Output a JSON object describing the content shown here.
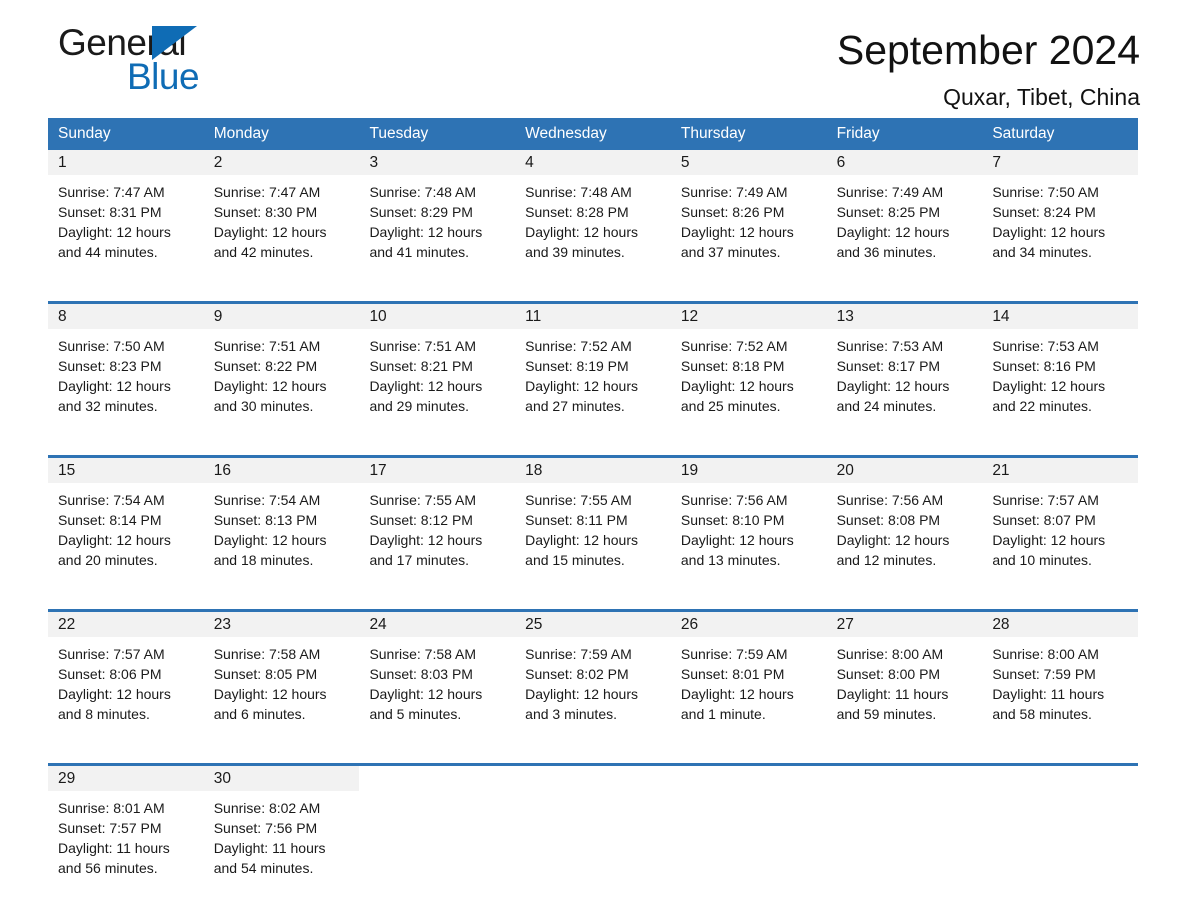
{
  "brand": {
    "name_part1": "General",
    "name_part2": "Blue",
    "logo_icon": "triangle-logo-icon",
    "accent_color": "#0f6cb5"
  },
  "header": {
    "month_title": "September 2024",
    "location": "Quxar, Tibet, China"
  },
  "calendar": {
    "header_bg": "#2e73b4",
    "day_band_bg": "#f2f2f2",
    "weekdays": [
      "Sunday",
      "Monday",
      "Tuesday",
      "Wednesday",
      "Thursday",
      "Friday",
      "Saturday"
    ],
    "weeks": [
      [
        {
          "date": "1",
          "sunrise": "Sunrise: 7:47 AM",
          "sunset": "Sunset: 8:31 PM",
          "daylight": "Daylight: 12 hours and 44 minutes."
        },
        {
          "date": "2",
          "sunrise": "Sunrise: 7:47 AM",
          "sunset": "Sunset: 8:30 PM",
          "daylight": "Daylight: 12 hours and 42 minutes."
        },
        {
          "date": "3",
          "sunrise": "Sunrise: 7:48 AM",
          "sunset": "Sunset: 8:29 PM",
          "daylight": "Daylight: 12 hours and 41 minutes."
        },
        {
          "date": "4",
          "sunrise": "Sunrise: 7:48 AM",
          "sunset": "Sunset: 8:28 PM",
          "daylight": "Daylight: 12 hours and 39 minutes."
        },
        {
          "date": "5",
          "sunrise": "Sunrise: 7:49 AM",
          "sunset": "Sunset: 8:26 PM",
          "daylight": "Daylight: 12 hours and 37 minutes."
        },
        {
          "date": "6",
          "sunrise": "Sunrise: 7:49 AM",
          "sunset": "Sunset: 8:25 PM",
          "daylight": "Daylight: 12 hours and 36 minutes."
        },
        {
          "date": "7",
          "sunrise": "Sunrise: 7:50 AM",
          "sunset": "Sunset: 8:24 PM",
          "daylight": "Daylight: 12 hours and 34 minutes."
        }
      ],
      [
        {
          "date": "8",
          "sunrise": "Sunrise: 7:50 AM",
          "sunset": "Sunset: 8:23 PM",
          "daylight": "Daylight: 12 hours and 32 minutes."
        },
        {
          "date": "9",
          "sunrise": "Sunrise: 7:51 AM",
          "sunset": "Sunset: 8:22 PM",
          "daylight": "Daylight: 12 hours and 30 minutes."
        },
        {
          "date": "10",
          "sunrise": "Sunrise: 7:51 AM",
          "sunset": "Sunset: 8:21 PM",
          "daylight": "Daylight: 12 hours and 29 minutes."
        },
        {
          "date": "11",
          "sunrise": "Sunrise: 7:52 AM",
          "sunset": "Sunset: 8:19 PM",
          "daylight": "Daylight: 12 hours and 27 minutes."
        },
        {
          "date": "12",
          "sunrise": "Sunrise: 7:52 AM",
          "sunset": "Sunset: 8:18 PM",
          "daylight": "Daylight: 12 hours and 25 minutes."
        },
        {
          "date": "13",
          "sunrise": "Sunrise: 7:53 AM",
          "sunset": "Sunset: 8:17 PM",
          "daylight": "Daylight: 12 hours and 24 minutes."
        },
        {
          "date": "14",
          "sunrise": "Sunrise: 7:53 AM",
          "sunset": "Sunset: 8:16 PM",
          "daylight": "Daylight: 12 hours and 22 minutes."
        }
      ],
      [
        {
          "date": "15",
          "sunrise": "Sunrise: 7:54 AM",
          "sunset": "Sunset: 8:14 PM",
          "daylight": "Daylight: 12 hours and 20 minutes."
        },
        {
          "date": "16",
          "sunrise": "Sunrise: 7:54 AM",
          "sunset": "Sunset: 8:13 PM",
          "daylight": "Daylight: 12 hours and 18 minutes."
        },
        {
          "date": "17",
          "sunrise": "Sunrise: 7:55 AM",
          "sunset": "Sunset: 8:12 PM",
          "daylight": "Daylight: 12 hours and 17 minutes."
        },
        {
          "date": "18",
          "sunrise": "Sunrise: 7:55 AM",
          "sunset": "Sunset: 8:11 PM",
          "daylight": "Daylight: 12 hours and 15 minutes."
        },
        {
          "date": "19",
          "sunrise": "Sunrise: 7:56 AM",
          "sunset": "Sunset: 8:10 PM",
          "daylight": "Daylight: 12 hours and 13 minutes."
        },
        {
          "date": "20",
          "sunrise": "Sunrise: 7:56 AM",
          "sunset": "Sunset: 8:08 PM",
          "daylight": "Daylight: 12 hours and 12 minutes."
        },
        {
          "date": "21",
          "sunrise": "Sunrise: 7:57 AM",
          "sunset": "Sunset: 8:07 PM",
          "daylight": "Daylight: 12 hours and 10 minutes."
        }
      ],
      [
        {
          "date": "22",
          "sunrise": "Sunrise: 7:57 AM",
          "sunset": "Sunset: 8:06 PM",
          "daylight": "Daylight: 12 hours and 8 minutes."
        },
        {
          "date": "23",
          "sunrise": "Sunrise: 7:58 AM",
          "sunset": "Sunset: 8:05 PM",
          "daylight": "Daylight: 12 hours and 6 minutes."
        },
        {
          "date": "24",
          "sunrise": "Sunrise: 7:58 AM",
          "sunset": "Sunset: 8:03 PM",
          "daylight": "Daylight: 12 hours and 5 minutes."
        },
        {
          "date": "25",
          "sunrise": "Sunrise: 7:59 AM",
          "sunset": "Sunset: 8:02 PM",
          "daylight": "Daylight: 12 hours and 3 minutes."
        },
        {
          "date": "26",
          "sunrise": "Sunrise: 7:59 AM",
          "sunset": "Sunset: 8:01 PM",
          "daylight": "Daylight: 12 hours and 1 minute."
        },
        {
          "date": "27",
          "sunrise": "Sunrise: 8:00 AM",
          "sunset": "Sunset: 8:00 PM",
          "daylight": "Daylight: 11 hours and 59 minutes."
        },
        {
          "date": "28",
          "sunrise": "Sunrise: 8:00 AM",
          "sunset": "Sunset: 7:59 PM",
          "daylight": "Daylight: 11 hours and 58 minutes."
        }
      ],
      [
        {
          "date": "29",
          "sunrise": "Sunrise: 8:01 AM",
          "sunset": "Sunset: 7:57 PM",
          "daylight": "Daylight: 11 hours and 56 minutes."
        },
        {
          "date": "30",
          "sunrise": "Sunrise: 8:02 AM",
          "sunset": "Sunset: 7:56 PM",
          "daylight": "Daylight: 11 hours and 54 minutes."
        },
        {
          "date": "",
          "sunrise": "",
          "sunset": "",
          "daylight": ""
        },
        {
          "date": "",
          "sunrise": "",
          "sunset": "",
          "daylight": ""
        },
        {
          "date": "",
          "sunrise": "",
          "sunset": "",
          "daylight": ""
        },
        {
          "date": "",
          "sunrise": "",
          "sunset": "",
          "daylight": ""
        },
        {
          "date": "",
          "sunrise": "",
          "sunset": "",
          "daylight": ""
        }
      ]
    ]
  }
}
